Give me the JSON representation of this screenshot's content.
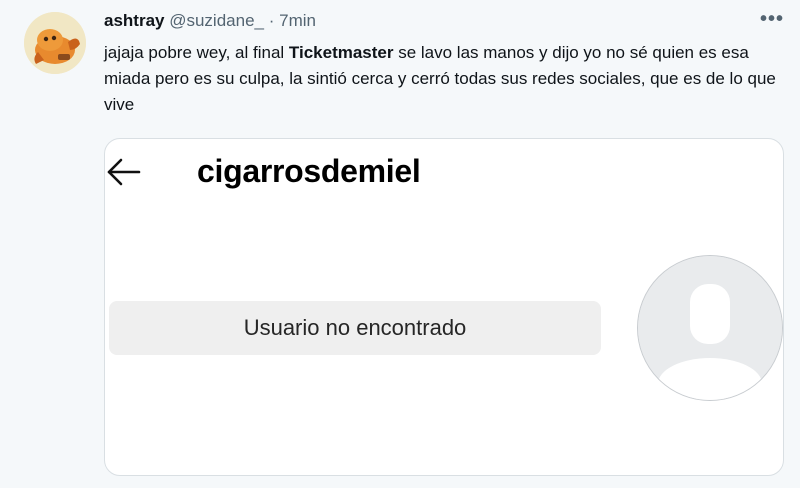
{
  "tweet": {
    "author_name": "ashtray",
    "author_handle": "@suzidane_",
    "separator": "·",
    "time": "7min",
    "more_label": "•••",
    "text_before": "jajaja pobre wey, al final ",
    "text_bold": "Ticketmaster",
    "text_after": " se lavo las manos y dijo yo no sé quien es esa miada pero es su culpa, la sintió cerca y cerró todas sus redes sociales, que es de lo que vive"
  },
  "embedded_screenshot": {
    "username": "cigarrosdemiel",
    "status": "Usuario no encontrado"
  },
  "colors": {
    "background": "#f5f8fa",
    "secondary_text": "#536471",
    "card_border": "#d9dfe3",
    "status_pill": "#efefef"
  },
  "icons": {
    "avatar": "cartoon-character-avatar",
    "more": "more-options-icon",
    "back": "back-arrow-icon",
    "profile": "default-profile-picture"
  }
}
